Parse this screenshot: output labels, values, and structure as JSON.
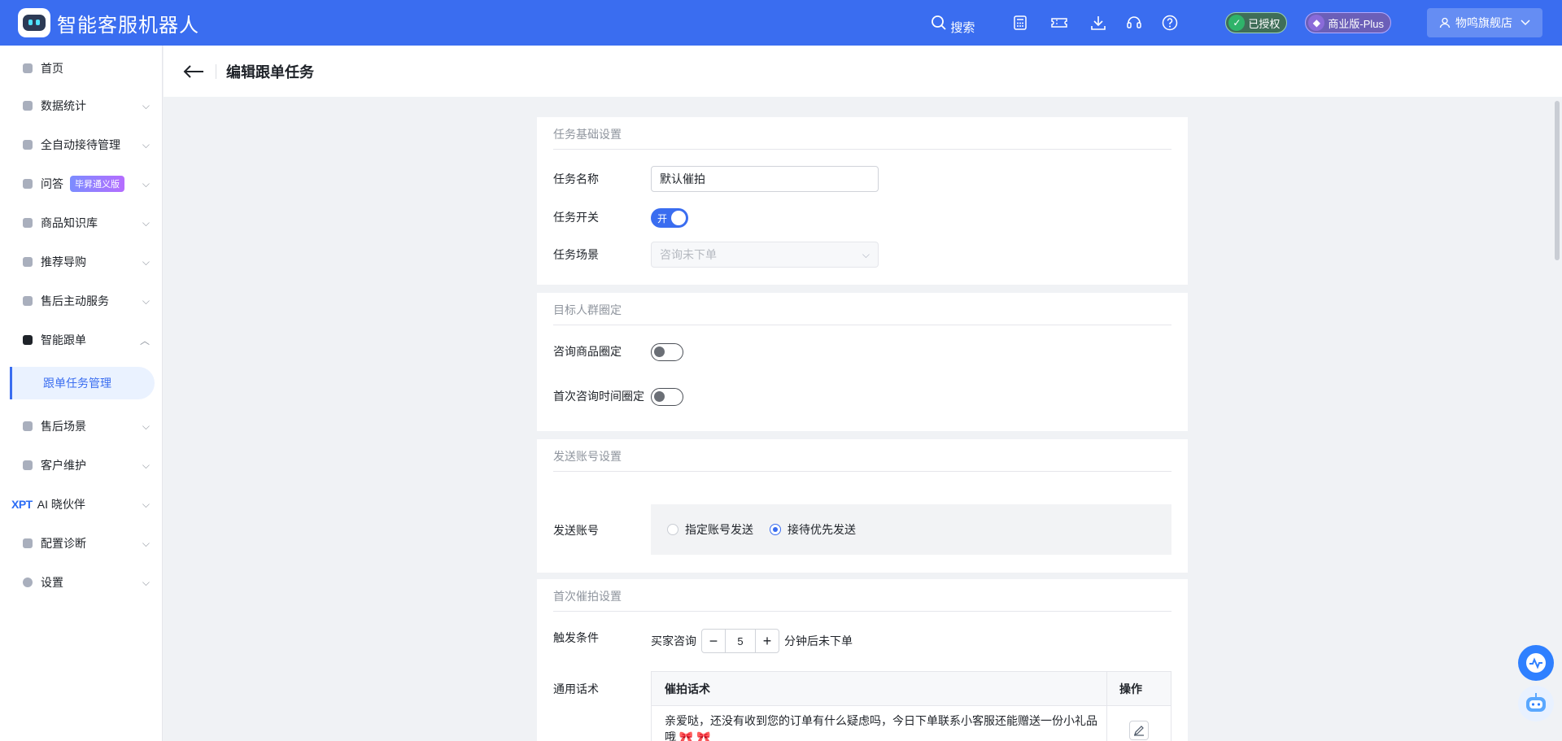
{
  "app": {
    "title": "智能客服机器人"
  },
  "topbar": {
    "search_label": "搜索",
    "auth_badge": "已授权",
    "plan_badge": "商业版-Plus",
    "user_name": "物鸣旗舰店",
    "icons": [
      "calculator-icon",
      "ticket-icon",
      "download-icon",
      "headset-icon",
      "help-icon"
    ]
  },
  "sidebar": {
    "items": [
      {
        "label": "首页"
      },
      {
        "label": "数据统计"
      },
      {
        "label": "全自动接待管理"
      },
      {
        "label": "问答",
        "tag": "毕昇通义版"
      },
      {
        "label": "商品知识库"
      },
      {
        "label": "推荐导购"
      },
      {
        "label": "售后主动服务"
      },
      {
        "label": "智能跟单"
      },
      {
        "label": "售后场景"
      },
      {
        "label": "客户维护"
      },
      {
        "label": "AI 晓伙伴",
        "prefix": "XPT"
      },
      {
        "label": "配置诊断"
      },
      {
        "label": "设置"
      }
    ],
    "active_sub": "跟单任务管理"
  },
  "page": {
    "title": "编辑跟单任务"
  },
  "basic": {
    "section_title": "任务基础设置",
    "name_label": "任务名称",
    "name_value": "默认催拍",
    "switch_label": "任务开关",
    "switch_text": "开",
    "scene_label": "任务场景",
    "scene_value": "咨询未下单"
  },
  "target": {
    "section_title": "目标人群圈定",
    "goods_label": "咨询商品圈定",
    "time_label": "首次咨询时间圈定"
  },
  "account": {
    "section_title": "发送账号设置",
    "label": "发送账号",
    "option1": "指定账号发送",
    "option2": "接待优先发送",
    "selected": "接待优先发送"
  },
  "first_push": {
    "section_title": "首次催拍设置",
    "trigger_label": "触发条件",
    "trigger_prefix": "买家咨询",
    "trigger_value": "5",
    "trigger_suffix": "分钟后未下单",
    "script_label": "通用话术",
    "table_col1": "催拍话术",
    "table_col2": "操作",
    "script_text": "亲爱哒，还没有收到您的订单有什么疑虑吗，今日下单联系小客服还能赠送一份小礼品哦"
  },
  "colors": {
    "primary": "#3a6df0",
    "topbar": "#3a6df0"
  }
}
